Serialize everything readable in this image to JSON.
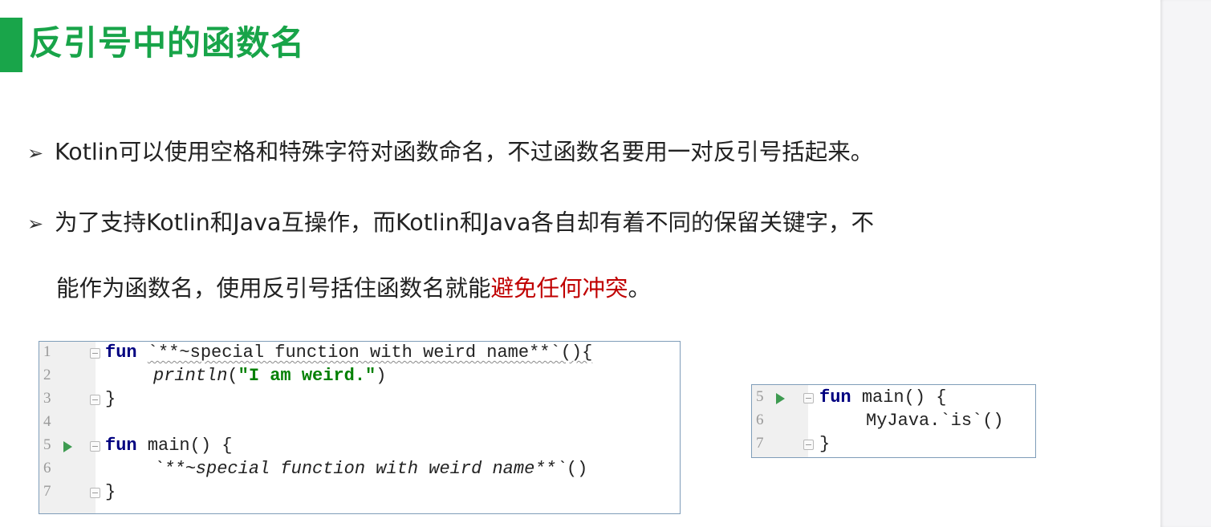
{
  "title": "反引号中的函数名",
  "bullets": [
    {
      "arrow": "➢",
      "text": "Kotlin可以使用空格和特殊字符对函数命名，不过函数名要用一对反引号括起来。"
    },
    {
      "arrow": "➢",
      "text": "为了支持Kotlin和Java互操作，而Kotlin和Java各自却有着不同的保留关键字，不"
    }
  ],
  "continuation": {
    "text_before": "能作为函数名，使用反引号括住函数名就能",
    "highlight": "避免任何冲突",
    "text_after": "。",
    "highlight_color": "#c00000"
  },
  "code1": {
    "lines": [
      {
        "n": "1",
        "kw": "fun",
        "rest": "`**~special function with weird name**`(){"
      },
      {
        "n": "2",
        "fn": "println",
        "open": "(",
        "str": "\"I am weird.\"",
        "close": ")"
      },
      {
        "n": "3",
        "rest": "}"
      },
      {
        "n": "4",
        "rest": ""
      },
      {
        "n": "5",
        "kw": "fun",
        "rest": "main() {"
      },
      {
        "n": "6",
        "call": "`**~special function with weird name**`",
        "tail": "()"
      },
      {
        "n": "7",
        "rest": "}"
      }
    ]
  },
  "code2": {
    "lines": [
      {
        "n": "5",
        "kw": "fun",
        "rest": "main() {"
      },
      {
        "n": "6",
        "rest": "MyJava.`is`()"
      },
      {
        "n": "7",
        "rest": "}"
      }
    ]
  },
  "colors": {
    "accent": "#19a54a",
    "title": "#18a449",
    "highlight": "#c00000"
  }
}
